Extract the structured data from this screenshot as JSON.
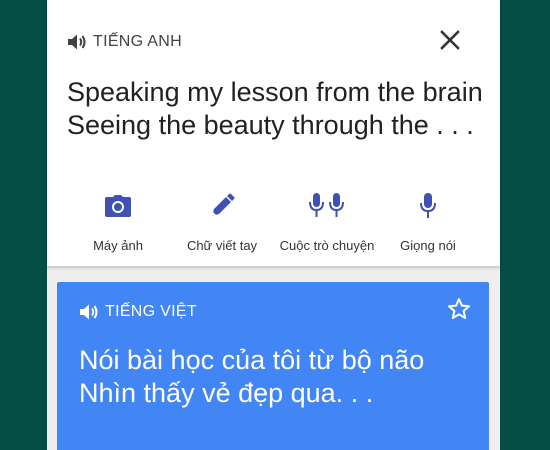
{
  "source": {
    "language": "TIẾNG ANH",
    "text": "Speaking my lesson from the brain Seeing the beauty through the . . .",
    "speaker_icon": "speaker-icon",
    "close_icon": "close-icon"
  },
  "tools": [
    {
      "label": "Máy ảnh",
      "icon": "camera-icon"
    },
    {
      "label": "Chữ viết tay",
      "icon": "pen-icon"
    },
    {
      "label": "Cuộc trò chuyện",
      "icon": "conversation-mic-icon"
    },
    {
      "label": "Giọng nói",
      "icon": "mic-icon"
    }
  ],
  "target": {
    "language": "TIẾNG VIỆT",
    "text": "Nói bài học của tôi từ bộ não Nhìn thấy vẻ đẹp qua.  .  .",
    "speaker_icon": "speaker-icon",
    "star_icon": "star-outline-icon"
  },
  "colors": {
    "background": "#054d45",
    "accent_blue": "#4285f4",
    "tool_icon": "#3f51b5"
  }
}
